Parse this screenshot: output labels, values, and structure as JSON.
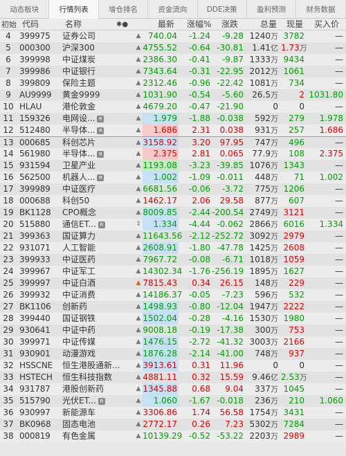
{
  "tabs": [
    "动态板块",
    "行情列表",
    "增仓排名",
    "资金流向",
    "DDE决策",
    "盈利预测",
    "财务数据"
  ],
  "header": {
    "index": "初始",
    "code": "代码",
    "name": "名称",
    "latest": "最新",
    "pct": "涨幅%",
    "change": "涨跌",
    "volume": "总量",
    "now": "现量",
    "buy": "买入价"
  },
  "rows": [
    {
      "idx": "4",
      "code": "399975",
      "name": "证券公司",
      "tag": false,
      "bell": "gray",
      "latest": "740.04",
      "pct": "-1.24",
      "chg": "-9.28",
      "vol": "1240",
      "vunit": "万",
      "now": "3782",
      "buy": "—",
      "dir": "down",
      "hl": "",
      "nowc": "green",
      "buyc": "blk"
    },
    {
      "idx": "5",
      "code": "000300",
      "name": "沪深300",
      "tag": false,
      "bell": "gray",
      "latest": "4755.52",
      "pct": "-0.64",
      "chg": "-30.81",
      "vol": "1.41",
      "vunit": "亿",
      "now": "1.73",
      "nunit": "万",
      "buy": "—",
      "dir": "down",
      "hl": "",
      "nowc": "red",
      "buyc": "blk"
    },
    {
      "idx": "6",
      "code": "399998",
      "name": "中证煤炭",
      "tag": false,
      "bell": "gray",
      "latest": "2386.30",
      "pct": "-0.41",
      "chg": "-9.87",
      "vol": "1333",
      "vunit": "万",
      "now": "9434",
      "buy": "—",
      "dir": "down",
      "hl": "",
      "nowc": "green",
      "buyc": "blk"
    },
    {
      "idx": "7",
      "code": "399986",
      "name": "中证银行",
      "tag": false,
      "bell": "gray",
      "latest": "7343.64",
      "pct": "-0.31",
      "chg": "-22.95",
      "vol": "2012",
      "vunit": "万",
      "now": "1061",
      "buy": "—",
      "dir": "down",
      "hl": "",
      "nowc": "green",
      "buyc": "blk"
    },
    {
      "idx": "8",
      "code": "399809",
      "name": "保险主题",
      "tag": false,
      "bell": "gray",
      "latest": "2312.46",
      "pct": "-0.96",
      "chg": "-22.42",
      "vol": "1081",
      "vunit": "万",
      "now": "734",
      "buy": "—",
      "dir": "down",
      "hl": "",
      "nowc": "green",
      "buyc": "blk"
    },
    {
      "idx": "9",
      "code": "AU9999",
      "name": "黄金9999",
      "tag": false,
      "bell": "gray",
      "latest": "1031.90",
      "pct": "-0.54",
      "chg": "-5.60",
      "vol": "26.5",
      "vunit": "万",
      "now": "2",
      "buy": "1031.80",
      "dir": "down",
      "hl": "",
      "nowc": "red",
      "buyc": "green"
    },
    {
      "idx": "10",
      "code": "HLAU",
      "name": "港伦敦金",
      "tag": false,
      "bell": "gray",
      "latest": "4679.20",
      "pct": "-0.47",
      "chg": "-21.90",
      "vol": "0",
      "vunit": "",
      "now": "0",
      "buy": "—",
      "dir": "down",
      "hl": "",
      "nowc": "blk",
      "buyc": "blk"
    },
    {
      "idx": "11",
      "code": "159326",
      "name": "电网设...",
      "tag": true,
      "bell": "gray",
      "latest": "1.979",
      "pct": "-1.88",
      "chg": "-0.038",
      "vol": "592",
      "vunit": "万",
      "now": "279",
      "buy": "1.978",
      "dir": "down",
      "hl": "blue",
      "nowc": "green",
      "buyc": "green"
    },
    {
      "idx": "12",
      "code": "512480",
      "name": "半导体...",
      "tag": true,
      "bell": "gray",
      "latest": "1.686",
      "pct": "2.31",
      "chg": "0.038",
      "vol": "931",
      "vunit": "万",
      "now": "257",
      "buy": "1.686",
      "dir": "up",
      "hl": "red",
      "nowc": "green",
      "buyc": "red"
    },
    {
      "idx": "13",
      "code": "000685",
      "name": "科创芯片",
      "tag": false,
      "bell": "gray",
      "latest": "3158.92",
      "pct": "3.20",
      "chg": "97.95",
      "vol": "747",
      "vunit": "万",
      "now": "496",
      "buy": "—",
      "dir": "up",
      "hl": "blue",
      "nowc": "green",
      "buyc": "blk"
    },
    {
      "idx": "14",
      "code": "561980",
      "name": "半导体...",
      "tag": true,
      "bell": "gray",
      "latest": "2.375",
      "pct": "2.81",
      "chg": "0.065",
      "vol": "77.9",
      "vunit": "万",
      "now": "108",
      "buy": "2.375",
      "dir": "up",
      "hl": "red",
      "nowc": "green",
      "buyc": "red"
    },
    {
      "idx": "15",
      "code": "931594",
      "name": "卫星产业",
      "tag": false,
      "bell": "gray",
      "latest": "1193.08",
      "pct": "-3.23",
      "chg": "-39.85",
      "vol": "1076",
      "vunit": "万",
      "now": "1343",
      "buy": "—",
      "dir": "down",
      "hl": "green",
      "nowc": "green",
      "buyc": "blk"
    },
    {
      "idx": "16",
      "code": "562500",
      "name": "机器人...",
      "tag": true,
      "bell": "gray",
      "latest": "1.002",
      "pct": "-1.09",
      "chg": "-0.011",
      "vol": "448",
      "vunit": "万",
      "now": "71",
      "buy": "1.002",
      "dir": "down",
      "hl": "blue",
      "nowc": "green",
      "buyc": "green"
    },
    {
      "idx": "17",
      "code": "399989",
      "name": "中证医疗",
      "tag": false,
      "bell": "gray",
      "latest": "6681.56",
      "pct": "-0.06",
      "chg": "-3.72",
      "vol": "775",
      "vunit": "万",
      "now": "1206",
      "buy": "—",
      "dir": "down",
      "hl": "",
      "nowc": "green",
      "buyc": "blk"
    },
    {
      "idx": "18",
      "code": "000688",
      "name": "科创50",
      "tag": false,
      "bell": "gray",
      "latest": "1462.17",
      "pct": "2.06",
      "chg": "29.58",
      "vol": "877",
      "vunit": "万",
      "now": "607",
      "buy": "—",
      "dir": "up",
      "hl": "",
      "nowc": "green",
      "buyc": "blk"
    },
    {
      "idx": "19",
      "code": "BK1128",
      "name": "CPO概念",
      "tag": false,
      "bell": "gray",
      "latest": "8009.85",
      "pct": "-2.44",
      "chg": "-200.54",
      "vol": "2749",
      "vunit": "万",
      "now": "3121",
      "buy": "—",
      "dir": "down",
      "hl": "blue",
      "nowc": "red",
      "buyc": "blk"
    },
    {
      "idx": "20",
      "code": "515880",
      "name": "通信ET...",
      "tag": true,
      "bell": "arrow",
      "latest": "1.334",
      "pct": "-4.44",
      "chg": "-0.062",
      "vol": "2866",
      "vunit": "万",
      "now": "6016",
      "buy": "1.334",
      "dir": "down",
      "hl": "blue",
      "nowc": "green",
      "buyc": "green"
    },
    {
      "idx": "21",
      "code": "399363",
      "name": "国证算力",
      "tag": false,
      "bell": "gray",
      "latest": "11643.56",
      "pct": "-2.12",
      "chg": "-252.72",
      "vol": "3092",
      "vunit": "万",
      "now": "2979",
      "buy": "—",
      "dir": "down",
      "hl": "",
      "nowc": "red",
      "buyc": "blk"
    },
    {
      "idx": "22",
      "code": "931071",
      "name": "人工智能",
      "tag": false,
      "bell": "gray",
      "latest": "2608.91",
      "pct": "-1.80",
      "chg": "-47.78",
      "vol": "1425",
      "vunit": "万",
      "now": "2608",
      "buy": "—",
      "dir": "down",
      "hl": "blue",
      "nowc": "red",
      "buyc": "blk"
    },
    {
      "idx": "23",
      "code": "399933",
      "name": "中证医药",
      "tag": false,
      "bell": "gray",
      "latest": "7967.72",
      "pct": "-0.08",
      "chg": "-6.71",
      "vol": "1018",
      "vunit": "万",
      "now": "1059",
      "buy": "—",
      "dir": "down",
      "hl": "",
      "nowc": "red",
      "buyc": "blk"
    },
    {
      "idx": "24",
      "code": "399967",
      "name": "中证军工",
      "tag": false,
      "bell": "gray",
      "latest": "14302.34",
      "pct": "-1.76",
      "chg": "-256.19",
      "vol": "1895",
      "vunit": "万",
      "now": "1627",
      "buy": "—",
      "dir": "down",
      "hl": "",
      "nowc": "green",
      "buyc": "blk"
    },
    {
      "idx": "25",
      "code": "399997",
      "name": "中证白酒",
      "tag": false,
      "bell": "red",
      "latest": "7815.43",
      "pct": "0.34",
      "chg": "26.15",
      "vol": "148",
      "vunit": "万",
      "now": "229",
      "buy": "—",
      "dir": "up",
      "hl": "",
      "nowc": "red",
      "buyc": "blk"
    },
    {
      "idx": "26",
      "code": "399932",
      "name": "中证消费",
      "tag": false,
      "bell": "gray",
      "latest": "14186.37",
      "pct": "-0.05",
      "chg": "-7.23",
      "vol": "596",
      "vunit": "万",
      "now": "532",
      "buy": "—",
      "dir": "down",
      "hl": "",
      "nowc": "green",
      "buyc": "blk"
    },
    {
      "idx": "27",
      "code": "BK1106",
      "name": "创新药",
      "tag": false,
      "bell": "gray",
      "latest": "1498.93",
      "pct": "-0.80",
      "chg": "-12.04",
      "vol": "1947",
      "vunit": "万",
      "now": "2222",
      "buy": "—",
      "dir": "down",
      "hl": "blue",
      "nowc": "red",
      "buyc": "blk"
    },
    {
      "idx": "28",
      "code": "399440",
      "name": "国证钢铁",
      "tag": false,
      "bell": "gray",
      "latest": "1502.04",
      "pct": "-0.28",
      "chg": "-4.16",
      "vol": "1530",
      "vunit": "万",
      "now": "1980",
      "buy": "—",
      "dir": "down",
      "hl": "blue",
      "nowc": "green",
      "buyc": "blk"
    },
    {
      "idx": "29",
      "code": "930641",
      "name": "中证中药",
      "tag": false,
      "bell": "gray",
      "latest": "9008.18",
      "pct": "-0.19",
      "chg": "-17.38",
      "vol": "300",
      "vunit": "万",
      "now": "753",
      "buy": "—",
      "dir": "down",
      "hl": "",
      "nowc": "red",
      "buyc": "blk"
    },
    {
      "idx": "30",
      "code": "399971",
      "name": "中证传媒",
      "tag": false,
      "bell": "gray",
      "latest": "1476.15",
      "pct": "-2.72",
      "chg": "-41.32",
      "vol": "3003",
      "vunit": "万",
      "now": "2166",
      "buy": "—",
      "dir": "down",
      "hl": "blue",
      "nowc": "red",
      "buyc": "blk"
    },
    {
      "idx": "31",
      "code": "930901",
      "name": "动漫游戏",
      "tag": false,
      "bell": "gray",
      "latest": "1876.28",
      "pct": "-2.14",
      "chg": "-41.00",
      "vol": "748",
      "vunit": "万",
      "now": "937",
      "buy": "—",
      "dir": "down",
      "hl": "blue",
      "nowc": "red",
      "buyc": "blk"
    },
    {
      "idx": "32",
      "code": "HSSCNE",
      "name": "恒生港股通新...",
      "tag": false,
      "bell": "gray",
      "latest": "3913.61",
      "pct": "0.31",
      "chg": "11.96",
      "vol": "0",
      "vunit": "",
      "now": "0",
      "buy": "—",
      "dir": "up",
      "hl": "blue",
      "nowc": "blk",
      "buyc": "blk"
    },
    {
      "idx": "33",
      "code": "HSTECH",
      "name": "恒生科技指数",
      "tag": false,
      "bell": "gray",
      "latest": "4881.11",
      "pct": "0.32",
      "chg": "15.59",
      "vol": "9.46",
      "vunit": "亿",
      "now": "2.53",
      "nunit": "万",
      "buy": "—",
      "dir": "up",
      "hl": "",
      "nowc": "green",
      "buyc": "blk"
    },
    {
      "idx": "34",
      "code": "931787",
      "name": "港股创新药",
      "tag": false,
      "bell": "gray",
      "latest": "1345.88",
      "pct": "0.68",
      "chg": "9.04",
      "vol": "337",
      "vunit": "万",
      "now": "1045",
      "buy": "—",
      "dir": "up",
      "hl": "blue",
      "nowc": "green",
      "buyc": "blk"
    },
    {
      "idx": "35",
      "code": "515790",
      "name": "光伏ET...",
      "tag": true,
      "bell": "gray",
      "latest": "1.060",
      "pct": "-1.67",
      "chg": "-0.018",
      "vol": "236",
      "vunit": "万",
      "now": "210",
      "buy": "1.060",
      "dir": "down",
      "hl": "blue",
      "nowc": "green",
      "buyc": "green"
    },
    {
      "idx": "36",
      "code": "930997",
      "name": "新能源车",
      "tag": false,
      "bell": "gray",
      "latest": "3306.86",
      "pct": "1.74",
      "chg": "56.58",
      "vol": "1754",
      "vunit": "万",
      "now": "3431",
      "buy": "—",
      "dir": "up",
      "hl": "",
      "nowc": "green",
      "buyc": "blk"
    },
    {
      "idx": "37",
      "code": "BK0968",
      "name": "固态电池",
      "tag": false,
      "bell": "gray",
      "latest": "2772.17",
      "pct": "0.26",
      "chg": "7.23",
      "vol": "5302",
      "vunit": "万",
      "now": "7284",
      "buy": "—",
      "dir": "up",
      "hl": "",
      "nowc": "green",
      "buyc": "blk"
    },
    {
      "idx": "38",
      "code": "000819",
      "name": "有色金属",
      "tag": false,
      "bell": "gray",
      "latest": "10139.29",
      "pct": "-0.52",
      "chg": "-53.22",
      "vol": "2203",
      "vunit": "万",
      "now": "2989",
      "buy": "—",
      "dir": "down",
      "hl": "",
      "nowc": "red",
      "buyc": "blk"
    }
  ]
}
